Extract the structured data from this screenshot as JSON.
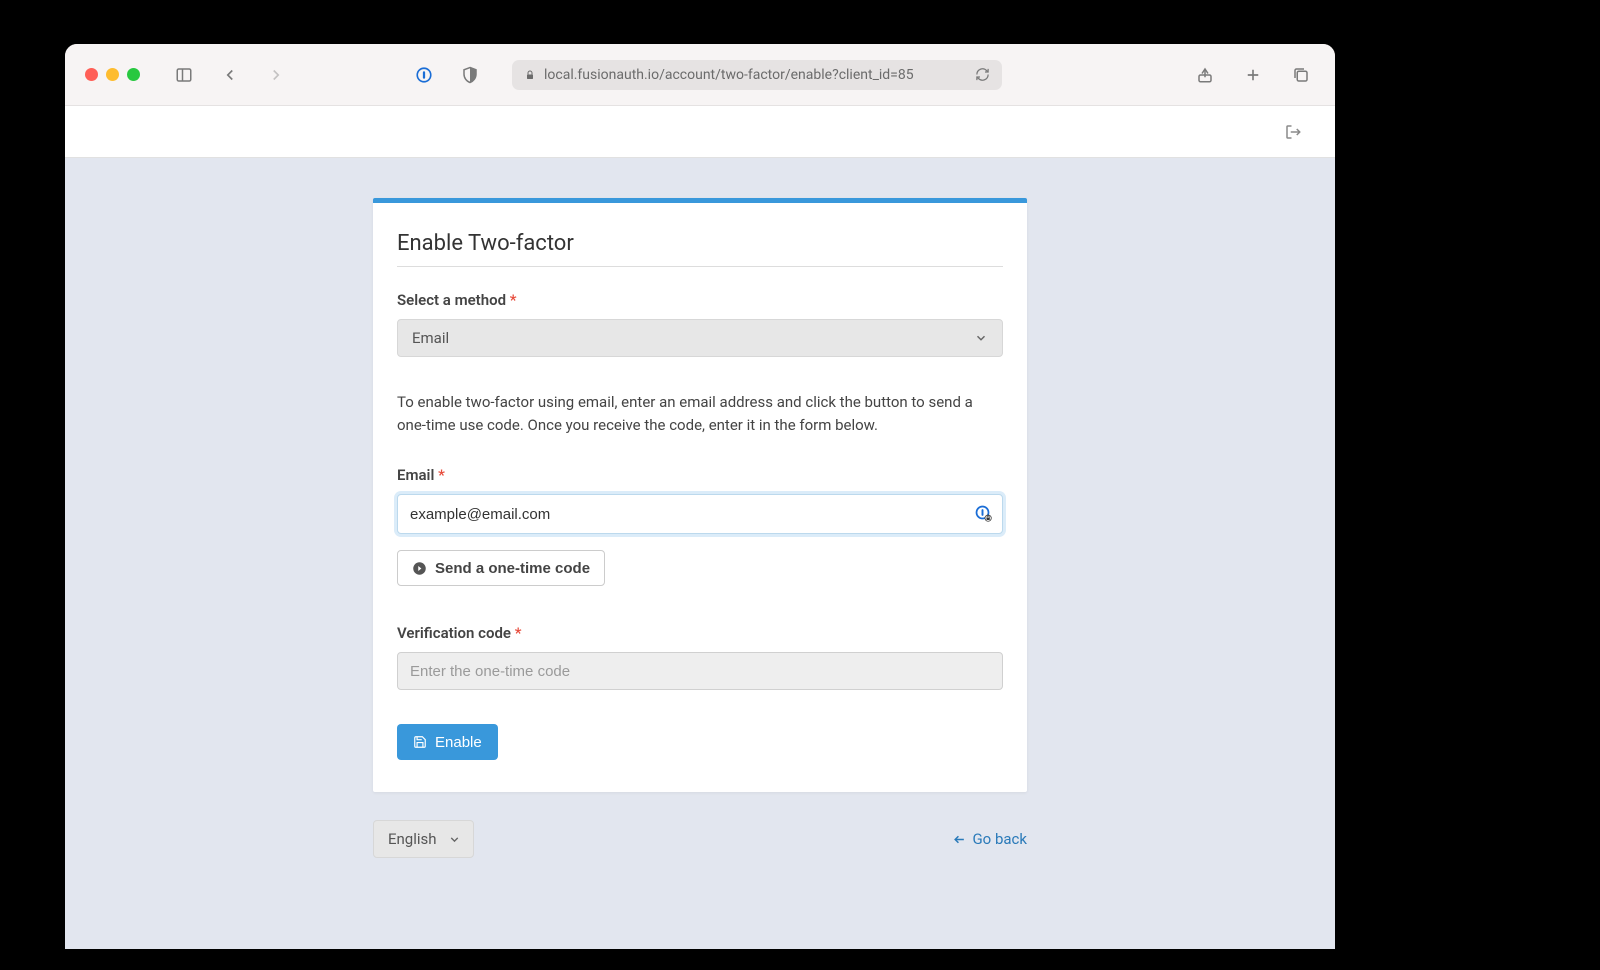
{
  "browser": {
    "url": "local.fusionauth.io/account/two-factor/enable?client_id=85"
  },
  "panel": {
    "title": "Enable Two-factor",
    "method_label": "Select a method",
    "method_value": "Email",
    "instructions": "To enable two-factor using email, enter an email address and click the button to send a one-time use code. Once you receive the code, enter it in the form below.",
    "email_label": "Email",
    "email_value": "example@email.com",
    "send_code_label": "Send a one-time code",
    "verification_label": "Verification code",
    "verification_placeholder": "Enter the one-time code",
    "enable_label": "Enable"
  },
  "footer": {
    "language": "English",
    "go_back": "Go back"
  },
  "required_marker": "*"
}
